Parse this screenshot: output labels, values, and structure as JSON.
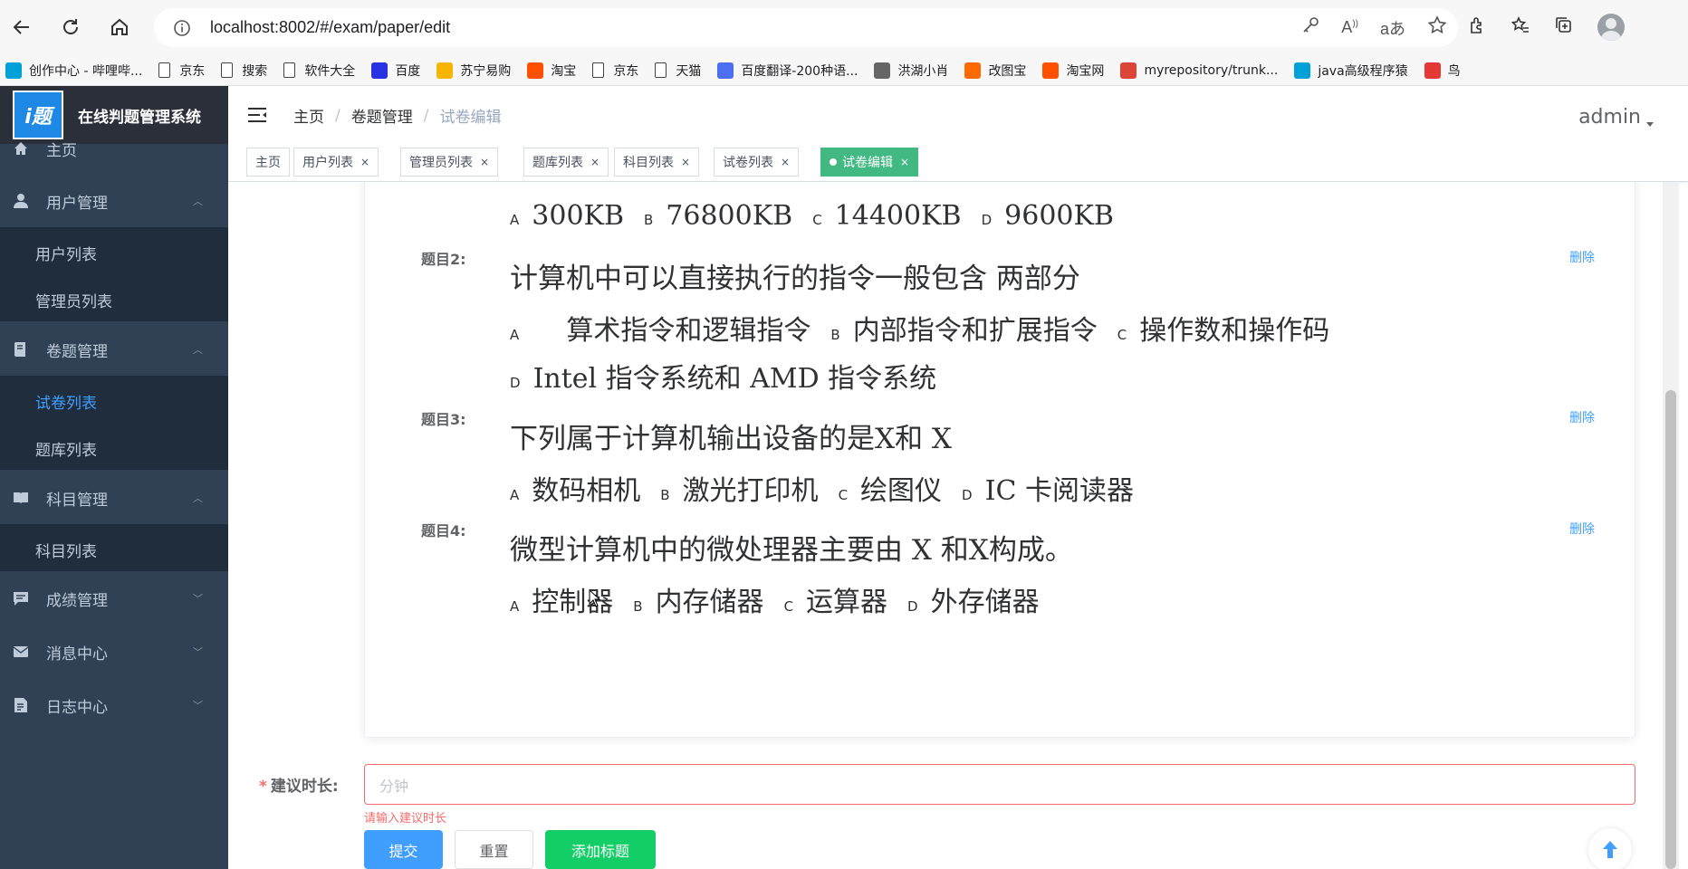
{
  "browser": {
    "url": "localhost:8002/#/exam/paper/edit",
    "bookmarks": [
      {
        "label": "创作中心 - 哔哩哔...",
        "icon": "bilibili-icon",
        "color": "#00a1d6"
      },
      {
        "label": "京东",
        "icon": "page-icon"
      },
      {
        "label": "搜索",
        "icon": "page-icon"
      },
      {
        "label": "软件大全",
        "icon": "page-icon"
      },
      {
        "label": "百度",
        "icon": "baidu-icon",
        "color": "#2932e1"
      },
      {
        "label": "苏宁易购",
        "icon": "suning-icon",
        "color": "#f7b500"
      },
      {
        "label": "淘宝",
        "icon": "taobao-icon",
        "color": "#ff5000"
      },
      {
        "label": "京东",
        "icon": "page-icon"
      },
      {
        "label": "天猫",
        "icon": "page-icon"
      },
      {
        "label": "百度翻译-200种语...",
        "icon": "baidu-translate-icon",
        "color": "#4e6ef2"
      },
      {
        "label": "洪湖小肖",
        "icon": "hawk-icon",
        "color": "#666666"
      },
      {
        "label": "改图宝",
        "icon": "gaitubao-icon",
        "color": "#ff6a00"
      },
      {
        "label": "淘宝网",
        "icon": "taobao-icon",
        "color": "#ff5000"
      },
      {
        "label": "myrepository/trunk...",
        "icon": "chrome-icon",
        "color": "#db4437"
      },
      {
        "label": "java高级程序猿",
        "icon": "bilibili-icon",
        "color": "#00a1d6"
      },
      {
        "label": "鸟",
        "icon": "bird-icon",
        "color": "#e53935"
      }
    ]
  },
  "sidebar": {
    "app_title": "在线判题管理系统",
    "logo_text": "i题",
    "menu": {
      "home": "主页",
      "user_mgmt": "用户管理",
      "user_list": "用户列表",
      "admin_list": "管理员列表",
      "paper_mgmt": "卷题管理",
      "paper_list": "试卷列表",
      "bank_list": "题库列表",
      "subject_mgmt": "科目管理",
      "subject_list": "科目列表",
      "score_mgmt": "成绩管理",
      "message_center": "消息中心",
      "log_center": "日志中心"
    }
  },
  "header": {
    "breadcrumb": [
      "主页",
      "卷题管理",
      "试卷编辑"
    ],
    "user": "admin"
  },
  "tags": [
    {
      "label": "主页",
      "closable": false
    },
    {
      "label": "用户列表",
      "closable": true
    },
    {
      "label": "管理员列表",
      "closable": true
    },
    {
      "label": "题库列表",
      "closable": true
    },
    {
      "label": "科目列表",
      "closable": true
    },
    {
      "label": "试卷列表",
      "closable": true
    },
    {
      "label": "试卷编辑",
      "closable": true,
      "active": true
    }
  ],
  "tag_close": "×",
  "questions": {
    "q1_options": [
      {
        "letter": "A",
        "text": "300KB"
      },
      {
        "letter": "B",
        "text": "76800KB"
      },
      {
        "letter": "C",
        "text": "14400KB"
      },
      {
        "letter": "D",
        "text": "9600KB"
      }
    ],
    "q2": {
      "label": "题目2:",
      "title": "计算机中可以直接执行的指令一般包含 两部分",
      "options": [
        {
          "letter": "A",
          "text": "    算术指令和逻辑指令"
        },
        {
          "letter": "B",
          "text": "内部指令和扩展指令"
        },
        {
          "letter": "C",
          "text": "操作数和操作码"
        },
        {
          "letter": "D",
          "text": "Intel 指令系统和 AMD 指令系统"
        }
      ]
    },
    "q3": {
      "label": "题目3:",
      "title": "下列属于计算机输出设备的是X和 X",
      "options": [
        {
          "letter": "A",
          "text": "数码相机"
        },
        {
          "letter": "B",
          "text": "激光打印机"
        },
        {
          "letter": "C",
          "text": "绘图仪"
        },
        {
          "letter": "D",
          "text": "IC 卡阅读器"
        }
      ]
    },
    "q4": {
      "label": "题目4:",
      "title": "微型计算机中的微处理器主要由 X 和X构成。",
      "options": [
        {
          "letter": "A",
          "text": "控制器"
        },
        {
          "letter": "B",
          "text": "内存储器"
        },
        {
          "letter": "C",
          "text": "运算器"
        },
        {
          "letter": "D",
          "text": "外存储器"
        }
      ]
    },
    "delete_label": "删除"
  },
  "form": {
    "required_mark": "*",
    "duration_label": "建议时长:",
    "duration_placeholder": "分钟",
    "duration_error": "请输入建议时长",
    "submit": "提交",
    "reset": "重置",
    "add_question": "添加标题"
  },
  "colors": {
    "sidebar_bg": "#304156",
    "submenu_bg": "#1f2d3d",
    "active_menu": "#409eff",
    "active_tag": "#42b983",
    "error": "#f56c6c"
  }
}
